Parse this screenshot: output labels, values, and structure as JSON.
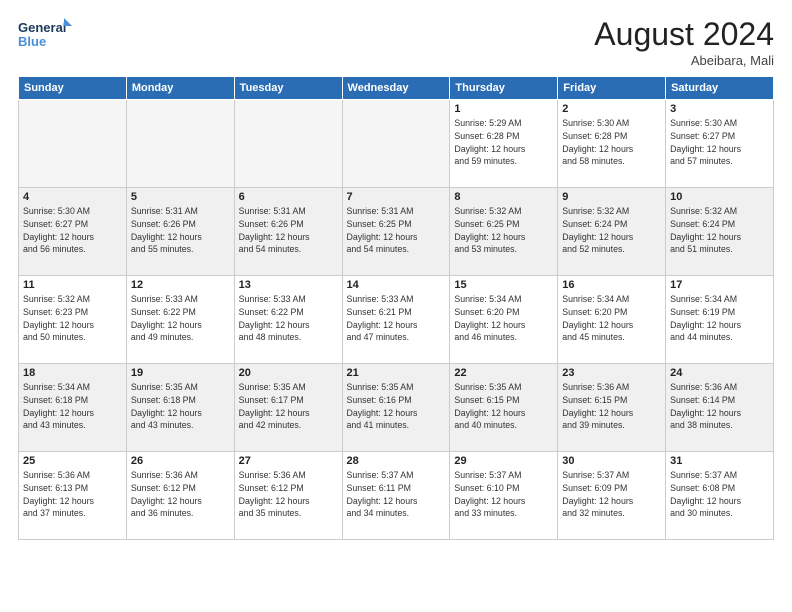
{
  "logo": {
    "line1": "General",
    "line2": "Blue"
  },
  "title": "August 2024",
  "location": "Abeibara, Mali",
  "days_header": [
    "Sunday",
    "Monday",
    "Tuesday",
    "Wednesday",
    "Thursday",
    "Friday",
    "Saturday"
  ],
  "weeks": [
    [
      {
        "day": "",
        "info": ""
      },
      {
        "day": "",
        "info": ""
      },
      {
        "day": "",
        "info": ""
      },
      {
        "day": "",
        "info": ""
      },
      {
        "day": "1",
        "info": "Sunrise: 5:29 AM\nSunset: 6:28 PM\nDaylight: 12 hours\nand 59 minutes."
      },
      {
        "day": "2",
        "info": "Sunrise: 5:30 AM\nSunset: 6:28 PM\nDaylight: 12 hours\nand 58 minutes."
      },
      {
        "day": "3",
        "info": "Sunrise: 5:30 AM\nSunset: 6:27 PM\nDaylight: 12 hours\nand 57 minutes."
      }
    ],
    [
      {
        "day": "4",
        "info": "Sunrise: 5:30 AM\nSunset: 6:27 PM\nDaylight: 12 hours\nand 56 minutes."
      },
      {
        "day": "5",
        "info": "Sunrise: 5:31 AM\nSunset: 6:26 PM\nDaylight: 12 hours\nand 55 minutes."
      },
      {
        "day": "6",
        "info": "Sunrise: 5:31 AM\nSunset: 6:26 PM\nDaylight: 12 hours\nand 54 minutes."
      },
      {
        "day": "7",
        "info": "Sunrise: 5:31 AM\nSunset: 6:25 PM\nDaylight: 12 hours\nand 54 minutes."
      },
      {
        "day": "8",
        "info": "Sunrise: 5:32 AM\nSunset: 6:25 PM\nDaylight: 12 hours\nand 53 minutes."
      },
      {
        "day": "9",
        "info": "Sunrise: 5:32 AM\nSunset: 6:24 PM\nDaylight: 12 hours\nand 52 minutes."
      },
      {
        "day": "10",
        "info": "Sunrise: 5:32 AM\nSunset: 6:24 PM\nDaylight: 12 hours\nand 51 minutes."
      }
    ],
    [
      {
        "day": "11",
        "info": "Sunrise: 5:32 AM\nSunset: 6:23 PM\nDaylight: 12 hours\nand 50 minutes."
      },
      {
        "day": "12",
        "info": "Sunrise: 5:33 AM\nSunset: 6:22 PM\nDaylight: 12 hours\nand 49 minutes."
      },
      {
        "day": "13",
        "info": "Sunrise: 5:33 AM\nSunset: 6:22 PM\nDaylight: 12 hours\nand 48 minutes."
      },
      {
        "day": "14",
        "info": "Sunrise: 5:33 AM\nSunset: 6:21 PM\nDaylight: 12 hours\nand 47 minutes."
      },
      {
        "day": "15",
        "info": "Sunrise: 5:34 AM\nSunset: 6:20 PM\nDaylight: 12 hours\nand 46 minutes."
      },
      {
        "day": "16",
        "info": "Sunrise: 5:34 AM\nSunset: 6:20 PM\nDaylight: 12 hours\nand 45 minutes."
      },
      {
        "day": "17",
        "info": "Sunrise: 5:34 AM\nSunset: 6:19 PM\nDaylight: 12 hours\nand 44 minutes."
      }
    ],
    [
      {
        "day": "18",
        "info": "Sunrise: 5:34 AM\nSunset: 6:18 PM\nDaylight: 12 hours\nand 43 minutes."
      },
      {
        "day": "19",
        "info": "Sunrise: 5:35 AM\nSunset: 6:18 PM\nDaylight: 12 hours\nand 43 minutes."
      },
      {
        "day": "20",
        "info": "Sunrise: 5:35 AM\nSunset: 6:17 PM\nDaylight: 12 hours\nand 42 minutes."
      },
      {
        "day": "21",
        "info": "Sunrise: 5:35 AM\nSunset: 6:16 PM\nDaylight: 12 hours\nand 41 minutes."
      },
      {
        "day": "22",
        "info": "Sunrise: 5:35 AM\nSunset: 6:15 PM\nDaylight: 12 hours\nand 40 minutes."
      },
      {
        "day": "23",
        "info": "Sunrise: 5:36 AM\nSunset: 6:15 PM\nDaylight: 12 hours\nand 39 minutes."
      },
      {
        "day": "24",
        "info": "Sunrise: 5:36 AM\nSunset: 6:14 PM\nDaylight: 12 hours\nand 38 minutes."
      }
    ],
    [
      {
        "day": "25",
        "info": "Sunrise: 5:36 AM\nSunset: 6:13 PM\nDaylight: 12 hours\nand 37 minutes."
      },
      {
        "day": "26",
        "info": "Sunrise: 5:36 AM\nSunset: 6:12 PM\nDaylight: 12 hours\nand 36 minutes."
      },
      {
        "day": "27",
        "info": "Sunrise: 5:36 AM\nSunset: 6:12 PM\nDaylight: 12 hours\nand 35 minutes."
      },
      {
        "day": "28",
        "info": "Sunrise: 5:37 AM\nSunset: 6:11 PM\nDaylight: 12 hours\nand 34 minutes."
      },
      {
        "day": "29",
        "info": "Sunrise: 5:37 AM\nSunset: 6:10 PM\nDaylight: 12 hours\nand 33 minutes."
      },
      {
        "day": "30",
        "info": "Sunrise: 5:37 AM\nSunset: 6:09 PM\nDaylight: 12 hours\nand 32 minutes."
      },
      {
        "day": "31",
        "info": "Sunrise: 5:37 AM\nSunset: 6:08 PM\nDaylight: 12 hours\nand 30 minutes."
      }
    ]
  ]
}
